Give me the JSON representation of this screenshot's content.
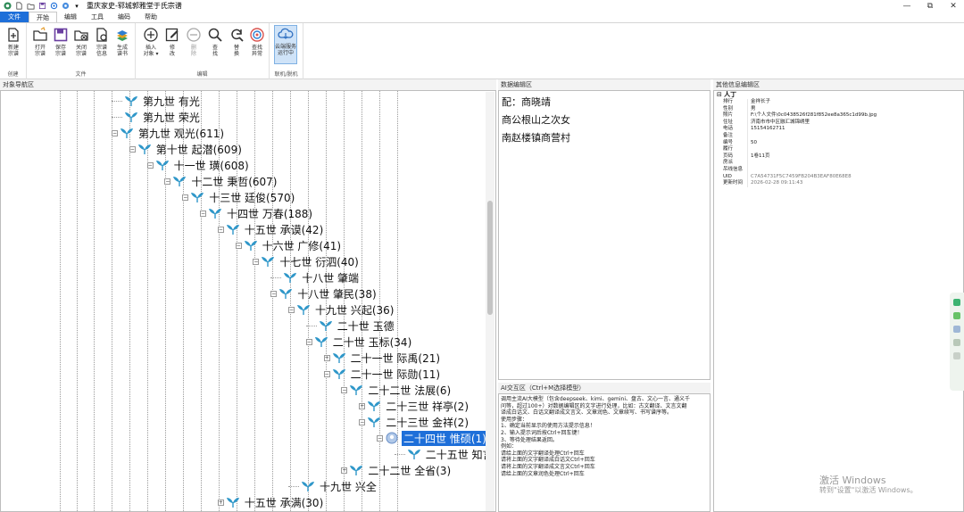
{
  "window": {
    "title": "重庆家史-郓城郭雅堂于氏宗谱",
    "controls": {
      "minimize": "—",
      "maximize": "⧉",
      "close": "✕"
    }
  },
  "tabs": [
    "文件",
    "开始",
    "编辑",
    "工具",
    "编码",
    "帮助"
  ],
  "ribbon": {
    "groups": [
      {
        "label": "创建",
        "buttons": [
          {
            "label": "新建\n宗谱",
            "icon": "new-file-icon"
          }
        ]
      },
      {
        "label": "文件",
        "buttons": [
          {
            "label": "打开\n宗谱",
            "icon": "open-folder-icon"
          },
          {
            "label": "保存\n宗谱",
            "icon": "save-icon"
          },
          {
            "label": "关闭\n宗谱",
            "icon": "close-folder-icon"
          },
          {
            "label": "宗谱\n信息",
            "icon": "info-gear-icon"
          },
          {
            "label": "生成\n谱书",
            "icon": "book-stack-icon"
          }
        ]
      },
      {
        "label": "编辑",
        "buttons": [
          {
            "label": "插入\n对象 ▾",
            "icon": "plus-circle-icon"
          },
          {
            "label": "修\n改",
            "icon": "edit-icon"
          },
          {
            "label": "删\n除",
            "icon": "minus-circle-icon",
            "disabled": true
          },
          {
            "label": "查\n找",
            "icon": "search-icon"
          },
          {
            "label": "替\n换",
            "icon": "replace-icon"
          },
          {
            "label": "查找\n异常",
            "icon": "target-icon"
          }
        ]
      },
      {
        "label": "联机/脱机",
        "buttons": [
          {
            "label": "云端服务\n运行中",
            "icon": "cloud-icon",
            "active": true
          }
        ]
      }
    ]
  },
  "panes": {
    "navigator": "对象导航区",
    "data_edit": "数据编辑区",
    "ai": "AI交互区（Ctrl+M选择模型）",
    "other_info": "其他信息编辑区"
  },
  "tree": [
    {
      "label": "第九世 有光",
      "level": 0,
      "toggle": ""
    },
    {
      "label": "第九世 荣光",
      "level": 0,
      "toggle": ""
    },
    {
      "label": "第九世 观光(611)",
      "level": 0,
      "toggle": "−"
    },
    {
      "label": "第十世 起潜(609)",
      "level": 1,
      "toggle": "−"
    },
    {
      "label": "十一世 璜(608)",
      "level": 2,
      "toggle": "−"
    },
    {
      "label": "十二世 秉哲(607)",
      "level": 3,
      "toggle": "−"
    },
    {
      "label": "十三世 廷俊(570)",
      "level": 4,
      "toggle": "−"
    },
    {
      "label": "十四世 万春(188)",
      "level": 5,
      "toggle": "−"
    },
    {
      "label": "十五世 承谟(42)",
      "level": 6,
      "toggle": "−"
    },
    {
      "label": "十六世 广修(41)",
      "level": 7,
      "toggle": "−"
    },
    {
      "label": "十七世 衍泗(40)",
      "level": 8,
      "toggle": "−"
    },
    {
      "label": "十八世 肇端",
      "level": 9,
      "toggle": ""
    },
    {
      "label": "十八世 肇民(38)",
      "level": 9,
      "toggle": "−"
    },
    {
      "label": "十九世 兴起(36)",
      "level": 10,
      "toggle": "−"
    },
    {
      "label": "二十世 玉德",
      "level": 11,
      "toggle": ""
    },
    {
      "label": "二十世 玉标(34)",
      "level": 11,
      "toggle": "−"
    },
    {
      "label": "二十一世 际禹(21)",
      "level": 12,
      "toggle": "+"
    },
    {
      "label": "二十一世 际勋(11)",
      "level": 12,
      "toggle": "−"
    },
    {
      "label": "二十二世 法展(6)",
      "level": 13,
      "toggle": "−"
    },
    {
      "label": "二十三世 祥亭(2)",
      "level": 14,
      "toggle": "+"
    },
    {
      "label": "二十三世 金祥(2)",
      "level": 14,
      "toggle": "−"
    },
    {
      "label": "二十四世 惟硕(1)",
      "level": 15,
      "toggle": "−",
      "selected": true
    },
    {
      "label": "二十五世 知言",
      "level": 16,
      "toggle": ""
    },
    {
      "label": "二十二世 全省(3)",
      "level": 13,
      "toggle": "+"
    },
    {
      "label": "十九世 兴全",
      "level": 10,
      "toggle": ""
    },
    {
      "label": "十五世 承满(30)",
      "level": 6,
      "toggle": "+"
    }
  ],
  "data_edit": {
    "lines": [
      "配：商晓靖",
      "商公根山之次女",
      "南赵楼镇商营村"
    ]
  },
  "ai": {
    "lines": [
      "调用主流AI大模型（包含deepseek、kimi、gemini、盘古、文心一言、通义千",
      "问等，超过100+）对数据编辑区的文字进行处理，比如：古文翻译、文言文翻",
      "译成白话文、白话文翻译成文言文、文章润色、文章续写、书写谱序等。",
      "使用步骤：",
      "1、确定当前显示的使用方法提示信息！",
      "2、输入提示词后按Ctrl+回车键！",
      "3、等待处理结果返回。",
      "例如：",
      "请给上面的文字翻译处理Ctrl+回车",
      "请将上面的文字翻译成白话文Ctrl+回车",
      "请将上面的文字翻译成文言文Ctrl+回车",
      "请给上面的文章润色处理Ctrl+回车"
    ]
  },
  "info": {
    "category": "人丁",
    "rows": [
      {
        "k": "排行",
        "v": "金祥长子"
      },
      {
        "k": "性别",
        "v": "男"
      },
      {
        "k": "照片",
        "v": "F:\\个人文件\\0c0438526f281f852ee8a365c1d99b.jpg"
      },
      {
        "k": "住址",
        "v": "济南市市中区融汇城锦绣里"
      },
      {
        "k": "电话",
        "v": "15154162711"
      },
      {
        "k": "备注",
        "v": ""
      },
      {
        "k": "编号",
        "v": "50"
      },
      {
        "k": "履行",
        "v": ""
      },
      {
        "k": "页码",
        "v": "1卷11页"
      },
      {
        "k": "房派",
        "v": ""
      },
      {
        "k": "吊线信息",
        "v": ""
      },
      {
        "k": "UID",
        "v": "C7A54731F5C7459FB204B3EAF80E68E8",
        "gray": true
      },
      {
        "k": "更新时间",
        "v": "2026-02-28 09:11:43",
        "gray": true
      }
    ]
  },
  "watermark": {
    "line1": "激活 Windows",
    "line2": "转到\"设置\"以激活 Windows。"
  },
  "colors": {
    "accent": "#1e6fd9",
    "leaf_icon": "#2f97c9"
  }
}
